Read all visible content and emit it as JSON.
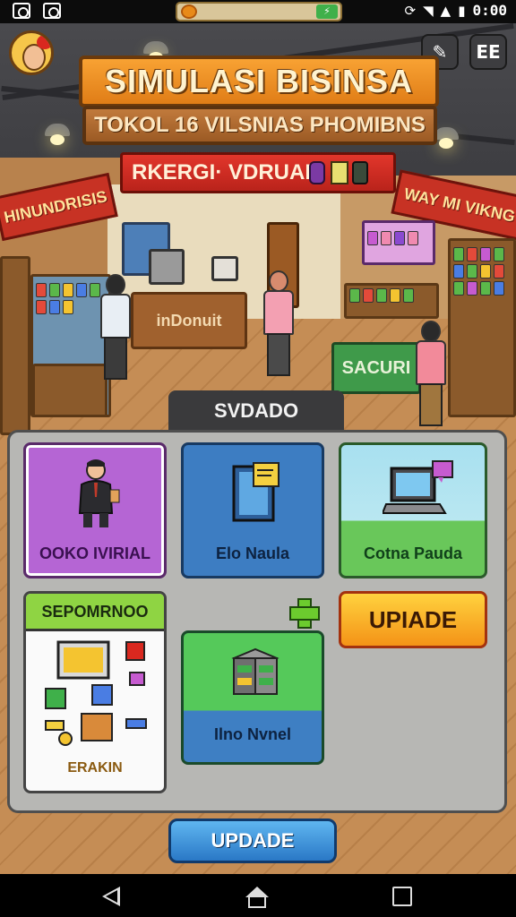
{
  "status_bar": {
    "time": "0:00"
  },
  "game": {
    "title": "SIMULASI BISINSA",
    "subtitle": "TOKOL 16 VILSNIAS PHOMIBNS",
    "red_banner_text": "RKERGI· VDRUAL",
    "store_signs": {
      "left": "HINUNDRISIS",
      "right": "WAY MI VIKNG",
      "counter_back": "inDonuit",
      "counter_front": "SACURI"
    },
    "top_buttons": {
      "edit": "✎",
      "menu": "EE"
    },
    "panel": {
      "section_tab": "SVDADO",
      "cards": [
        {
          "label": "OOKO IVIRIAL"
        },
        {
          "label": "Elo Naula"
        },
        {
          "label": "Cotna Pauda"
        },
        {
          "header": "SEPOMRNOO",
          "footer": "ERAKIN"
        },
        {
          "label": "Ilno Nvnel"
        }
      ],
      "upgrade_label": "UPIADE",
      "update_label": "UPDADE"
    }
  },
  "colors": {
    "title_orange": "#f8a233",
    "banner_red": "#e2362b",
    "card_purple": "#b565d4",
    "card_blue": "#3d7dc2",
    "card_green": "#55c95a",
    "upgrade_orange": "#f49317",
    "update_blue": "#2a78c6"
  },
  "icons": [
    "photo-icon",
    "map-icon",
    "wifi-icon",
    "signal-icon",
    "battery-icon",
    "edit-icon",
    "menu-icon",
    "plus-icon",
    "back-icon",
    "home-icon",
    "recent-apps-icon"
  ]
}
